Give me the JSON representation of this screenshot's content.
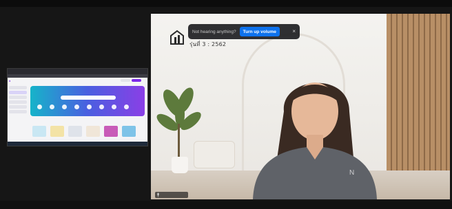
{
  "meeting": {
    "background_color": "#161616"
  },
  "notification": {
    "message": "Not hearing anything?",
    "action_label": "Turn up volume",
    "close_glyph": "×",
    "accent_color": "#0e72ed"
  },
  "overlay": {
    "logo_icon": "building-logo-icon",
    "date_text": "รุ่นที่ 3 : 2562"
  },
  "shared_screen": {
    "icon": "canva-homepage-thumbnail",
    "brand_color": "#7d2ae8"
  },
  "participant": {
    "name_tag_icon": "mic-icon"
  }
}
